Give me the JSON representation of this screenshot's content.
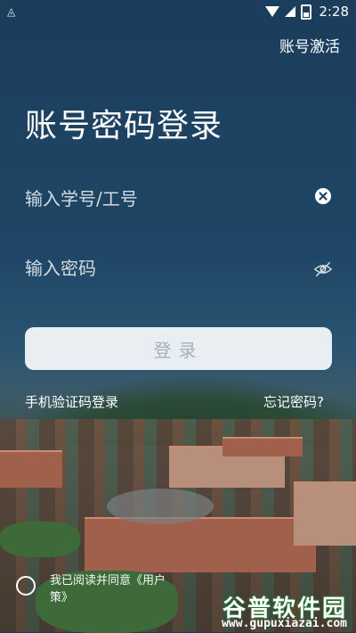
{
  "status_bar": {
    "time": "2:28"
  },
  "header": {
    "activate_label": "账号激活"
  },
  "main": {
    "title": "账号密码登录",
    "id_input": {
      "placeholder": "输入学号/工号",
      "value": ""
    },
    "password_input": {
      "placeholder": "输入密码",
      "value": ""
    },
    "login_label": "登录",
    "sms_login_label": "手机验证码登录",
    "forgot_password_label": "忘记密码?"
  },
  "footer": {
    "agree_prefix": "我已阅读并同意《用户",
    "agree_suffix": "策》"
  },
  "watermark": {
    "brand": "谷普软件园",
    "url": "www.gupuxiazai.com"
  },
  "colors": {
    "login_button_bg": "#e9eef2",
    "login_button_text": "#a7b0b8"
  }
}
